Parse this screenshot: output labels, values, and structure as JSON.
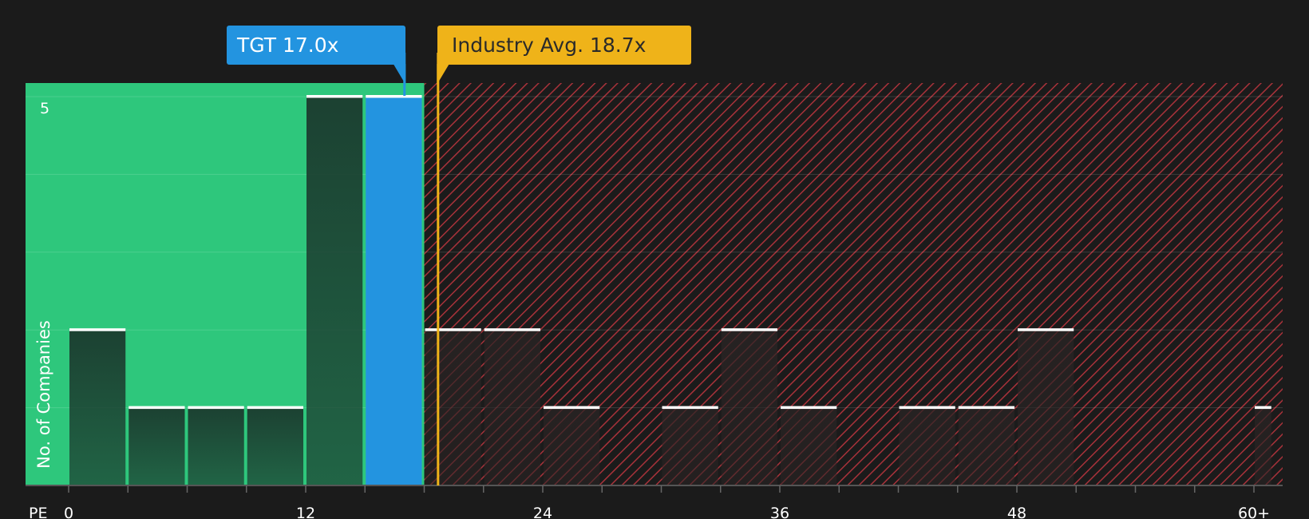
{
  "colors": {
    "background": "#1b1b1b",
    "fair_zone": "#2ec77c",
    "over_zone": "#a8323a",
    "company": "#2394e0",
    "industry": "#efb319",
    "bar_fill": "#1f3a30",
    "bar_top": "#ffffff"
  },
  "company_label": "TGT 17.0x",
  "industry_label": "Industry Avg. 18.7x",
  "chart_data": {
    "type": "bar",
    "title": "",
    "xlabel": "PE",
    "ylabel": "No. of Companies",
    "company": {
      "name": "TGT",
      "value": 17.0
    },
    "industry_average": 18.7,
    "xlim": [
      0,
      61
    ],
    "ylim": [
      0,
      5
    ],
    "x_tick_labels": [
      {
        "value": 0,
        "label": "0"
      },
      {
        "value": 12,
        "label": "12"
      },
      {
        "value": 24,
        "label": "24"
      },
      {
        "value": 36,
        "label": "36"
      },
      {
        "value": 48,
        "label": "48"
      },
      {
        "value": 60,
        "label": "60+"
      }
    ],
    "x_minor_ticks": [
      3,
      6,
      9,
      15,
      18,
      21,
      27,
      30,
      33,
      39,
      42,
      45,
      51,
      54,
      57
    ],
    "y_tick_labels": [
      {
        "value": 5,
        "label": "5"
      }
    ],
    "y_gridlines": [
      1,
      2,
      3,
      4,
      5
    ],
    "bins": [
      {
        "start": 0,
        "end": 3,
        "value": 2
      },
      {
        "start": 3,
        "end": 6,
        "value": 1
      },
      {
        "start": 6,
        "end": 9,
        "value": 1
      },
      {
        "start": 9,
        "end": 12,
        "value": 1
      },
      {
        "start": 12,
        "end": 15,
        "value": 5
      },
      {
        "start": 15,
        "end": 18,
        "value": 5,
        "highlight": true
      },
      {
        "start": 18,
        "end": 21,
        "value": 2
      },
      {
        "start": 21,
        "end": 24,
        "value": 2
      },
      {
        "start": 24,
        "end": 27,
        "value": 1
      },
      {
        "start": 27,
        "end": 30,
        "value": 0
      },
      {
        "start": 30,
        "end": 33,
        "value": 1
      },
      {
        "start": 33,
        "end": 36,
        "value": 2
      },
      {
        "start": 36,
        "end": 39,
        "value": 1
      },
      {
        "start": 39,
        "end": 42,
        "value": 0
      },
      {
        "start": 42,
        "end": 45,
        "value": 1
      },
      {
        "start": 45,
        "end": 48,
        "value": 1
      },
      {
        "start": 48,
        "end": 51,
        "value": 2
      },
      {
        "start": 51,
        "end": 54,
        "value": 0
      },
      {
        "start": 54,
        "end": 57,
        "value": 0
      },
      {
        "start": 57,
        "end": 60,
        "value": 0
      },
      {
        "start": 60,
        "end": 61,
        "value": 1
      }
    ]
  }
}
